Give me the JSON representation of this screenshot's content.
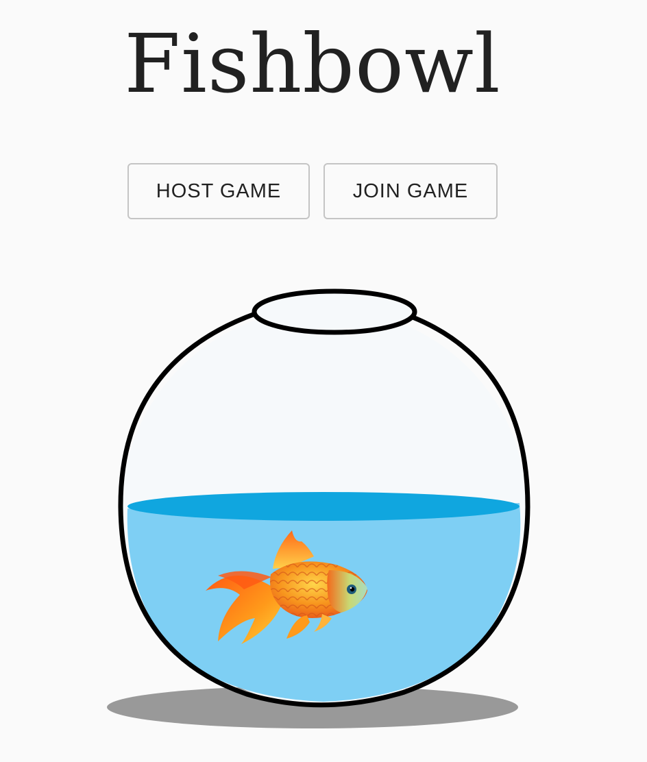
{
  "title": "Fishbowl",
  "buttons": {
    "host_label": "HOST GAME",
    "join_label": "JOIN GAME"
  },
  "colors": {
    "background": "#fafafa",
    "text": "#212121",
    "button_border": "#c4c4c4",
    "water": "#7ecff4",
    "water_surface": "#10a6df",
    "bowl_outline": "#000000",
    "shadow": "#999999",
    "fish_body": "#f7941d"
  },
  "illustration": {
    "bowl": "fishbowl-icon",
    "fish": "goldfish-icon"
  }
}
